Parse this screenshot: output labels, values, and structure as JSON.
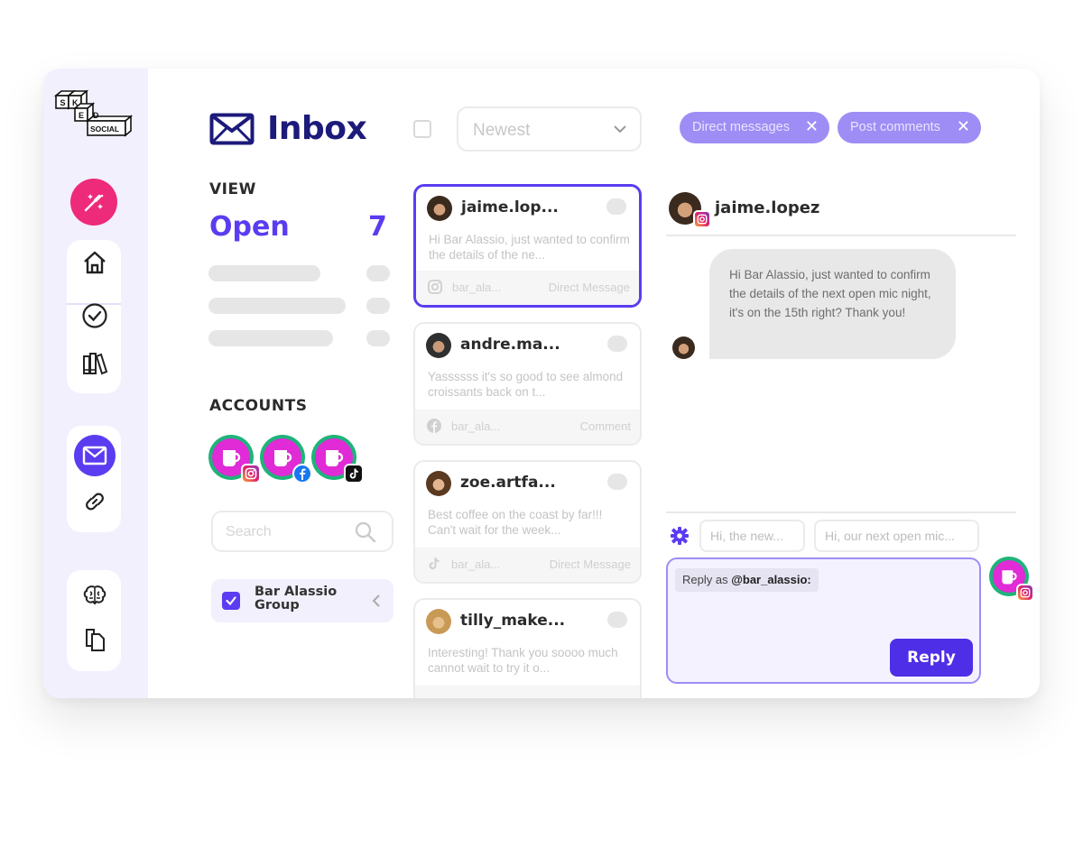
{
  "brand": {
    "logo_letters": [
      "S",
      "K",
      "E",
      "D"
    ],
    "logo_word": "SOCIAL"
  },
  "colors": {
    "accent": "#5b3cf0",
    "navy": "#1c1a7a",
    "compose": "#ee2a7b",
    "rail": "#f2f0fd",
    "chip": "#9e8df5",
    "reply": "#4f2ee8"
  },
  "sidebar": {
    "icons": [
      "magic-pen-icon",
      "home-icon",
      "check-circle-icon",
      "library-icon",
      "inbox-icon",
      "link-icon",
      "brain-icon",
      "copy-icon"
    ]
  },
  "header": {
    "title": "Inbox"
  },
  "view": {
    "label": "VIEW",
    "current": "Open",
    "count": "7"
  },
  "accounts": {
    "label": "ACCOUNTS",
    "items": [
      {
        "network": "instagram"
      },
      {
        "network": "facebook"
      },
      {
        "network": "tiktok"
      }
    ],
    "search_placeholder": "Search",
    "group": {
      "label": "Bar Alassio Group",
      "checked": true
    }
  },
  "list": {
    "sort": {
      "selected": "Newest"
    },
    "cards": [
      {
        "name": "jaime.lop...",
        "preview": "Hi Bar Alassio, just wanted to confirm the details of the ne...",
        "account": "bar_ala...",
        "type": "Direct Message",
        "network": "instagram",
        "selected": true
      },
      {
        "name": "andre.ma...",
        "preview": "Yassssss it's so good to see almond croissants back on t...",
        "account": "bar_ala...",
        "type": "Comment",
        "network": "facebook",
        "selected": false
      },
      {
        "name": "zoe.artfa...",
        "preview": "Best coffee on the coast by far!!! Can't wait for the week...",
        "account": "bar_ala...",
        "type": "Direct Message",
        "network": "tiktok",
        "selected": false
      },
      {
        "name": "tilly_make...",
        "preview": "Interesting! Thank you soooo much cannot wait to try it o...",
        "account": "",
        "type": "",
        "network": "instagram",
        "selected": false
      }
    ]
  },
  "filters": {
    "chips": [
      {
        "label": "Direct messages"
      },
      {
        "label": "Post comments"
      }
    ],
    "remove_glyph": "✕"
  },
  "conversation": {
    "contact": "jaime.lopez",
    "message": "Hi Bar Alassio, just wanted to confirm the details of the next open mic night, it's on the 15th right? Thank you!",
    "quick_replies": [
      "Hi, the new...",
      "Hi, our next open mic..."
    ],
    "reply_as_prefix": "Reply as ",
    "reply_as_handle": "@bar_alassio:",
    "reply_button": "Reply"
  }
}
